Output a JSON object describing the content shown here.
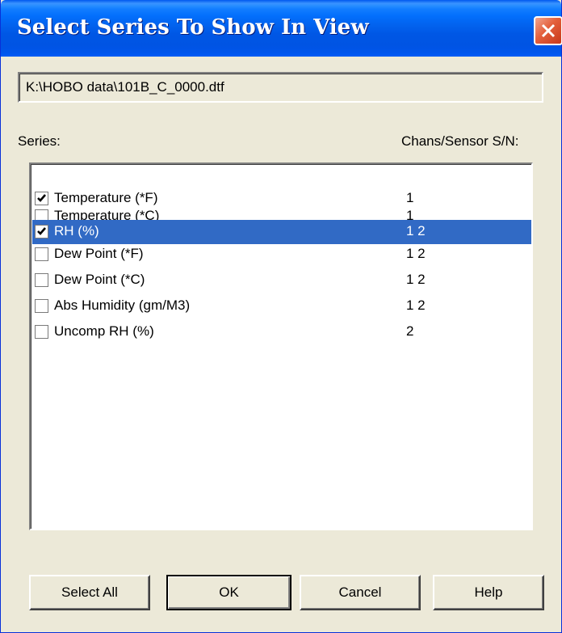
{
  "window": {
    "title": "Select Series To Show In View"
  },
  "file_path": "K:\\HOBO data\\101B_C_0000.dtf",
  "labels": {
    "series": "Series:",
    "chans": "Chans/Sensor S/N:"
  },
  "series": [
    {
      "label": "Temperature (*F)",
      "chans": "1",
      "checked": true,
      "selected": false
    },
    {
      "label": "Temperature (*C)",
      "chans": "1",
      "checked": false,
      "selected": false
    },
    {
      "label": "RH (%)",
      "chans": "1 2",
      "checked": true,
      "selected": true
    },
    {
      "label": "Dew Point (*F)",
      "chans": "1 2",
      "checked": false,
      "selected": false
    },
    {
      "label": "Dew Point (*C)",
      "chans": "1 2",
      "checked": false,
      "selected": false
    },
    {
      "label": "Abs Humidity (gm/M3)",
      "chans": "1 2",
      "checked": false,
      "selected": false
    },
    {
      "label": "Uncomp RH (%)",
      "chans": "2",
      "checked": false,
      "selected": false
    }
  ],
  "buttons": {
    "select_all": "Select All",
    "ok": "OK",
    "cancel": "Cancel",
    "help": "Help"
  },
  "colors": {
    "selection": "#316ac5",
    "title_bar": "#0054e3",
    "close_button": "#e35f3b"
  }
}
